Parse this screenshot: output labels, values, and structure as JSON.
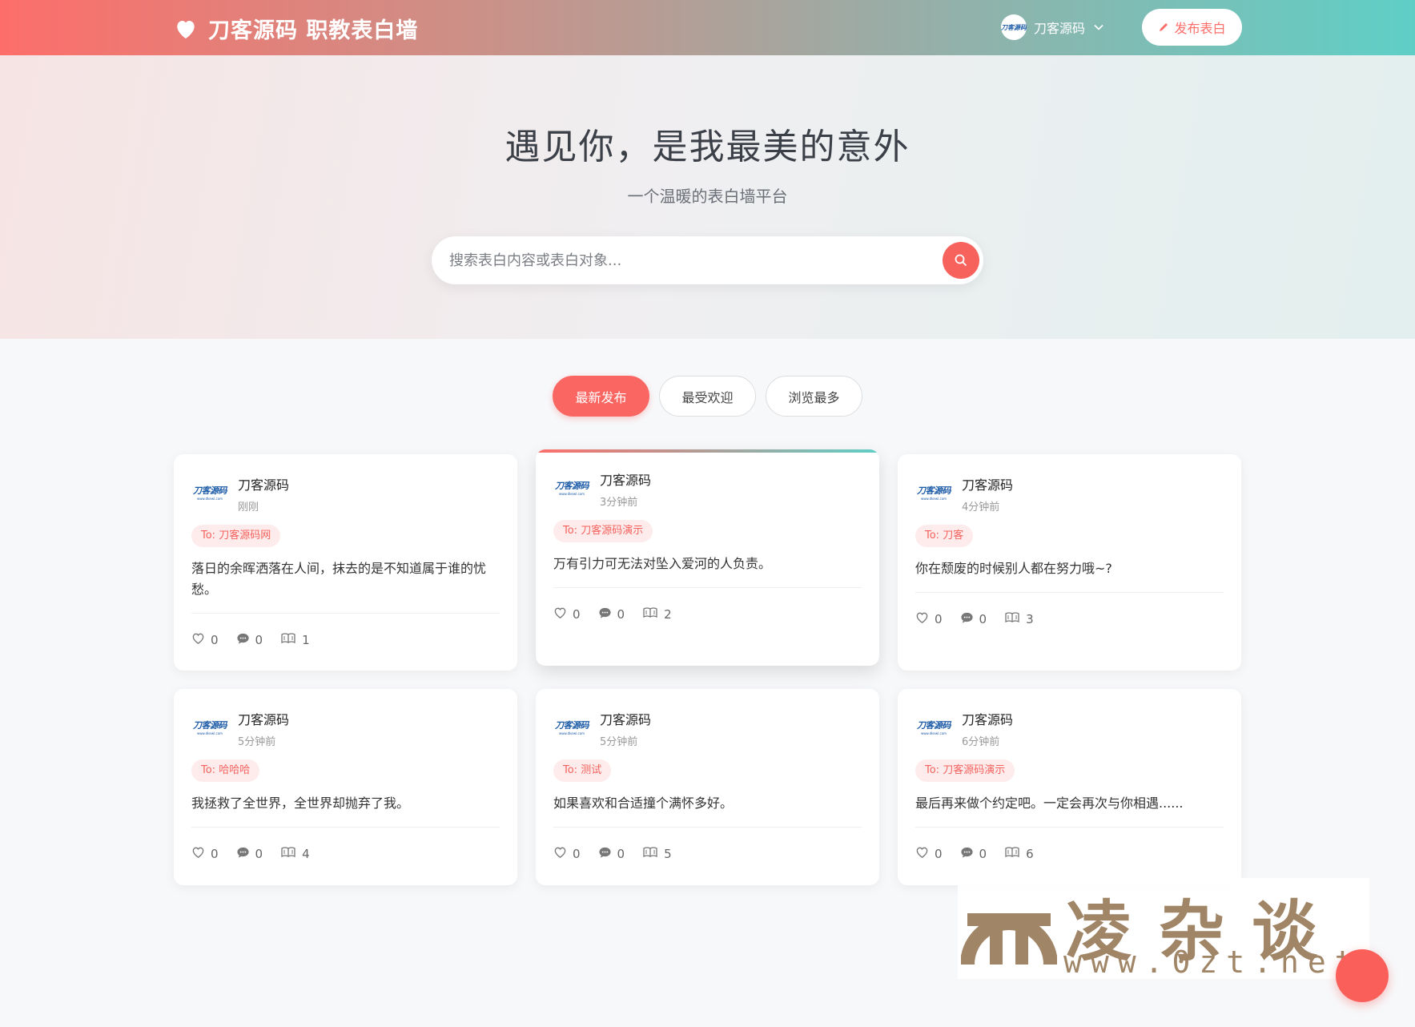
{
  "header": {
    "brand_title": "刀客源码 职教表白墙",
    "user_name": "刀客源码",
    "avatar_logo": "刀客源码",
    "publish_label": "发布表白"
  },
  "hero": {
    "title": "遇见你，是我最美的意外",
    "subtitle": "一个温暖的表白墙平台",
    "search_placeholder": "搜索表白内容或表白对象..."
  },
  "tabs": [
    {
      "label": "最新发布",
      "active": true
    },
    {
      "label": "最受欢迎",
      "active": false
    },
    {
      "label": "浏览最多",
      "active": false
    }
  ],
  "cards": [
    {
      "avatar_logo": "刀客源码",
      "avatar_sub": "www.dkewl.com",
      "author": "刀客源码",
      "time": "刚刚",
      "to": "To: 刀客源码网",
      "content": "落日的余晖洒落在人间，抹去的是不知道属于谁的忧愁。",
      "likes": "0",
      "comments": "0",
      "views": "1"
    },
    {
      "avatar_logo": "刀客源码",
      "avatar_sub": "www.dkewl.com",
      "author": "刀客源码",
      "time": "3分钟前",
      "to": "To: 刀客源码演示",
      "content": "万有引力可无法对坠入爱河的人负责。",
      "likes": "0",
      "comments": "0",
      "views": "2"
    },
    {
      "avatar_logo": "刀客源码",
      "avatar_sub": "www.dkewl.com",
      "author": "刀客源码",
      "time": "4分钟前",
      "to": "To: 刀客",
      "content": "你在颓废的时候别人都在努力哦~?",
      "likes": "0",
      "comments": "0",
      "views": "3"
    },
    {
      "avatar_logo": "刀客源码",
      "avatar_sub": "www.dkewl.com",
      "author": "刀客源码",
      "time": "5分钟前",
      "to": "To: 哈哈哈",
      "content": "我拯救了全世界，全世界却抛弃了我。",
      "likes": "0",
      "comments": "0",
      "views": "4"
    },
    {
      "avatar_logo": "刀客源码",
      "avatar_sub": "www.dkewl.com",
      "author": "刀客源码",
      "time": "5分钟前",
      "to": "To: 测试",
      "content": "如果喜欢和合适撞个满怀多好。",
      "likes": "0",
      "comments": "0",
      "views": "5"
    },
    {
      "avatar_logo": "刀客源码",
      "avatar_sub": "www.dkewl.com",
      "author": "刀客源码",
      "time": "6分钟前",
      "to": "To: 刀客源码演示",
      "content": "最后再来做个约定吧。一定会再次与你相遇......",
      "likes": "0",
      "comments": "0",
      "views": "6"
    }
  ],
  "watermark": {
    "chars": "凌杂谈",
    "url": "www.0zt.net"
  },
  "colors": {
    "accent": "#fa6763",
    "header_left": "#fd6e6a",
    "header_right": "#5fcfc6"
  }
}
